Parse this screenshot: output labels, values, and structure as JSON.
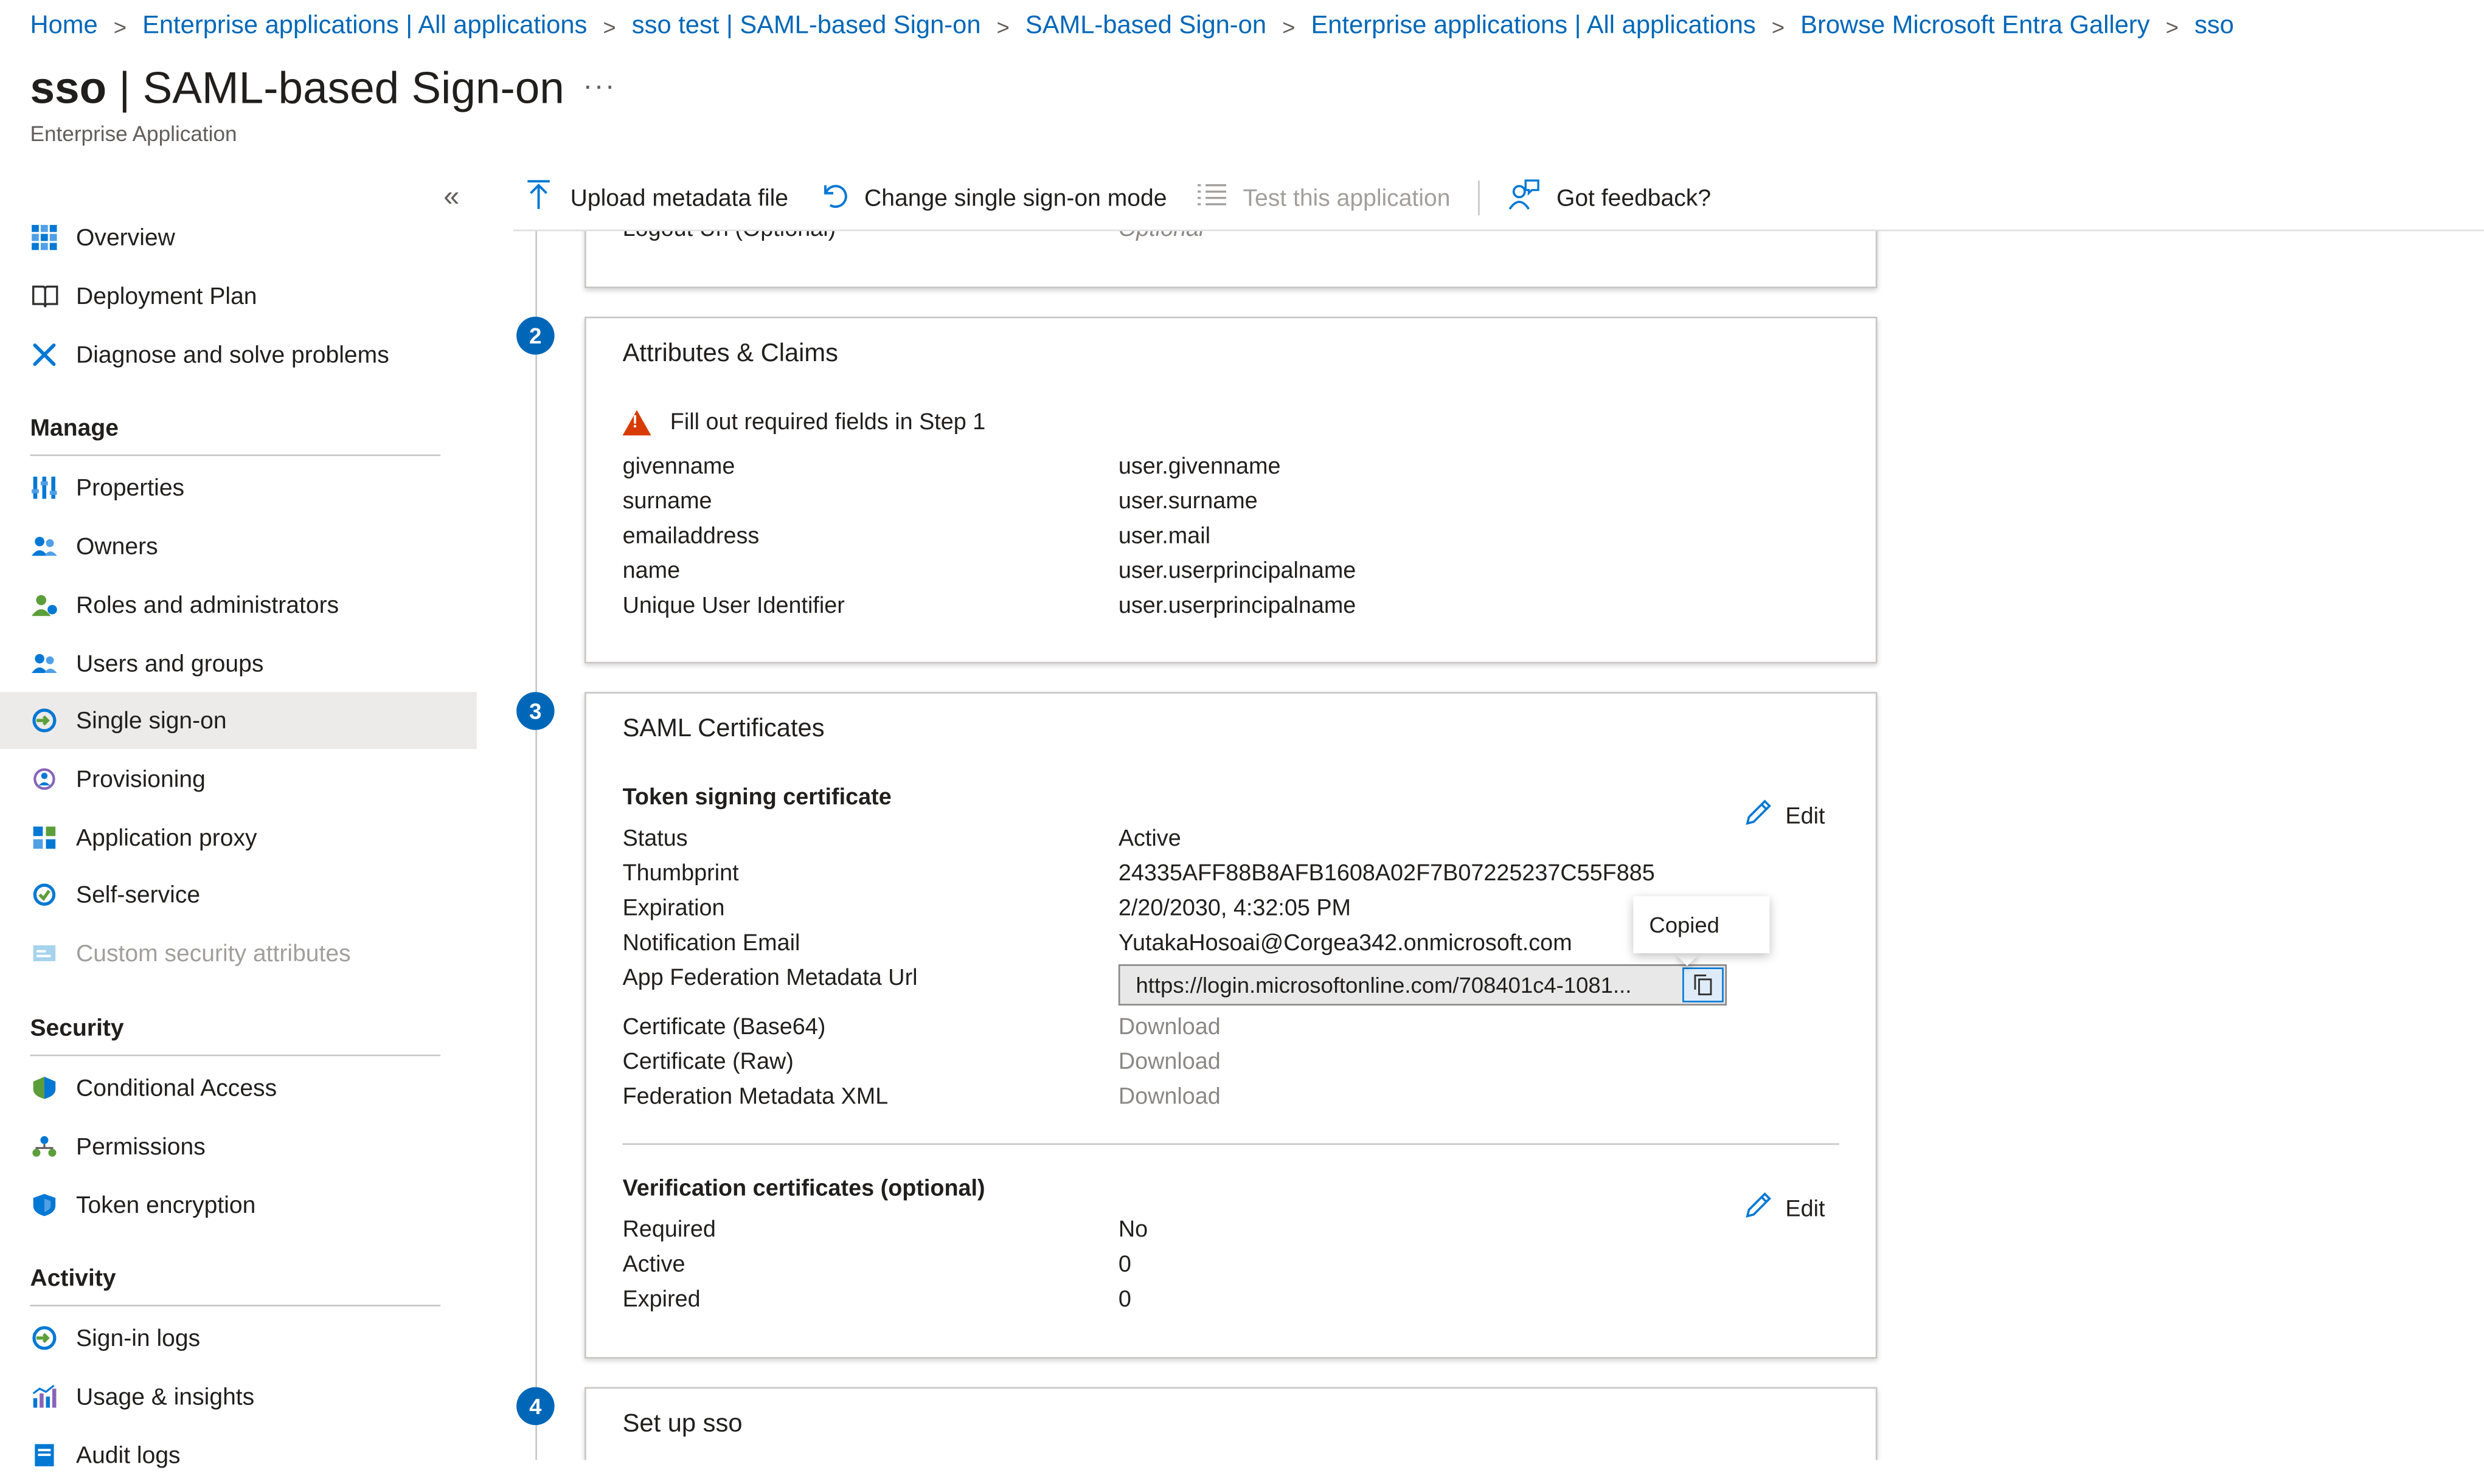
{
  "breadcrumb": [
    "Home",
    "Enterprise applications | All applications",
    "sso test | SAML-based Sign-on",
    "SAML-based Sign-on",
    "Enterprise applications | All applications",
    "Browse Microsoft Entra Gallery",
    "sso"
  ],
  "header": {
    "title_name": "sso",
    "title_rest": " | SAML-based Sign-on",
    "more": "···",
    "subtitle": "Enterprise Application"
  },
  "sidebar": {
    "collapse": "«",
    "top_items": [
      {
        "label": "Overview",
        "icon": "overview-grid-icon"
      },
      {
        "label": "Deployment Plan",
        "icon": "book-icon"
      },
      {
        "label": "Diagnose and solve problems",
        "icon": "wrench-icon"
      }
    ],
    "manage_label": "Manage",
    "manage_items": [
      {
        "label": "Properties",
        "icon": "properties-icon"
      },
      {
        "label": "Owners",
        "icon": "owners-icon"
      },
      {
        "label": "Roles and administrators",
        "icon": "roles-icon"
      },
      {
        "label": "Users and groups",
        "icon": "users-groups-icon"
      },
      {
        "label": "Single sign-on",
        "icon": "sso-icon"
      },
      {
        "label": "Provisioning",
        "icon": "provisioning-icon"
      },
      {
        "label": "Application proxy",
        "icon": "app-proxy-icon"
      },
      {
        "label": "Self-service",
        "icon": "self-service-icon"
      },
      {
        "label": "Custom security attributes",
        "icon": "custom-attributes-icon"
      }
    ],
    "security_label": "Security",
    "security_items": [
      {
        "label": "Conditional Access",
        "icon": "conditional-access-icon"
      },
      {
        "label": "Permissions",
        "icon": "permissions-icon"
      },
      {
        "label": "Token encryption",
        "icon": "shield-icon"
      }
    ],
    "activity_label": "Activity",
    "activity_items": [
      {
        "label": "Sign-in logs",
        "icon": "sign-in-logs-icon"
      },
      {
        "label": "Usage & insights",
        "icon": "usage-insights-icon"
      },
      {
        "label": "Audit logs",
        "icon": "audit-logs-icon"
      }
    ]
  },
  "toolbar": {
    "upload": "Upload metadata file",
    "change_mode": "Change single sign-on mode",
    "test": "Test this application",
    "feedback": "Got feedback?"
  },
  "section1": {
    "logout_label": "Logout Url (Optional)",
    "logout_value": "Optional"
  },
  "section2": {
    "step": "2",
    "title": "Attributes & Claims",
    "warning": "Fill out required fields in Step 1",
    "claims": [
      {
        "k": "givenname",
        "v": "user.givenname"
      },
      {
        "k": "surname",
        "v": "user.surname"
      },
      {
        "k": "emailaddress",
        "v": "user.mail"
      },
      {
        "k": "name",
        "v": "user.userprincipalname"
      },
      {
        "k": "Unique User Identifier",
        "v": "user.userprincipalname"
      }
    ]
  },
  "section3": {
    "step": "3",
    "title": "SAML Certificates",
    "token_title": "Token signing certificate",
    "edit": "Edit",
    "status_label": "Status",
    "status_value": "Active",
    "thumb_label": "Thumbprint",
    "thumb_value": "24335AFF88B8AFB1608A02F7B07225237C55F885",
    "exp_label": "Expiration",
    "exp_value": "2/20/2030, 4:32:05 PM",
    "notif_label": "Notification Email",
    "notif_value": "YutakaHosoai@Corgea342.onmicrosoft.com",
    "url_label": "App Federation Metadata Url",
    "url_value": "https://login.microsoftonline.com/708401c4-1081...",
    "copied": "Copied",
    "b64_label": "Certificate (Base64)",
    "raw_label": "Certificate (Raw)",
    "xml_label": "Federation Metadata XML",
    "download": "Download",
    "verif_title": "Verification certificates (optional)",
    "req_label": "Required",
    "req_value": "No",
    "active_label": "Active",
    "active_value": "0",
    "expired_label": "Expired",
    "expired_value": "0"
  },
  "section4": {
    "step": "4",
    "title": "Set up sso"
  },
  "colors": {
    "accent": "#0078d4",
    "link": "#0067b8",
    "warning": "#d83b01"
  }
}
